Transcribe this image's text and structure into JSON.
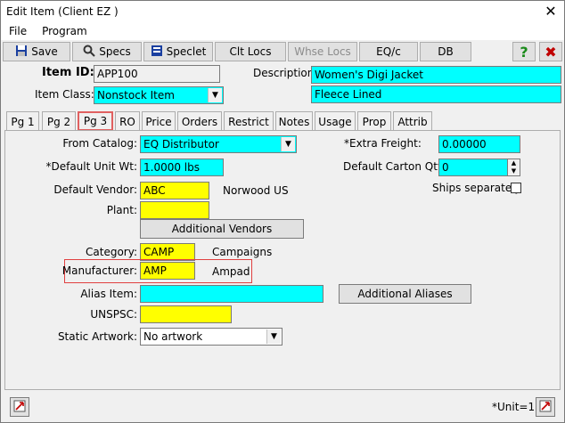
{
  "window": {
    "title": "Edit Item (Client EZ   )",
    "close_glyph": "✕"
  },
  "menu": {
    "items": [
      "File",
      "Program"
    ]
  },
  "toolbar": {
    "save": "Save",
    "specs": "Specs",
    "speclet": "Speclet",
    "clt_locs": "Clt Locs",
    "whse_locs": "Whse Locs",
    "eqc": "EQ/c",
    "db": "DB",
    "help_glyph": "?",
    "cancel_glyph": "✖"
  },
  "header": {
    "item_id_label": "Item ID:",
    "item_id_value": "APP100",
    "item_class_label": "Item Class:",
    "item_class_value": "Nonstock Item",
    "description_label": "Description:",
    "description_line1": "Women's Digi Jacket",
    "description_line2": "Fleece Lined"
  },
  "tabs": [
    "Pg 1",
    "Pg 2",
    "Pg 3",
    "RO",
    "Price",
    "Orders",
    "Restrict",
    "Notes",
    "Usage",
    "Prop",
    "Attrib"
  ],
  "active_tab": "Pg 3",
  "page3": {
    "from_catalog_label": "From Catalog:",
    "from_catalog_value": "EQ Distributor",
    "extra_freight_label": "*Extra Freight:",
    "extra_freight_value": "0.00000",
    "default_unit_wt_label": "*Default Unit Wt:",
    "default_unit_wt_value": "1.0000 lbs",
    "default_carton_qty_label": "Default Carton Qty:",
    "default_carton_qty_value": "0",
    "default_vendor_label": "Default Vendor:",
    "default_vendor_value": "ABC",
    "default_vendor_name": "Norwood US",
    "ships_separately_label": "Ships separately",
    "plant_label": "Plant:",
    "plant_value": "",
    "additional_vendors_button": "Additional Vendors",
    "category_label": "Category:",
    "category_value": "CAMP",
    "category_name": "Campaigns",
    "manufacturer_label": "Manufacturer:",
    "manufacturer_value": "AMP",
    "manufacturer_name": "Ampad",
    "alias_item_label": "Alias Item:",
    "alias_item_value": "",
    "additional_aliases_button": "Additional Aliases",
    "unspsc_label": "UNSPSC:",
    "unspsc_value": "",
    "static_artwork_label": "Static Artwork:",
    "static_artwork_value": "No artwork"
  },
  "footer": {
    "unit_text": "*Unit=1"
  },
  "colors": {
    "required": "#00ffff",
    "lookup": "#ffff00",
    "highlight_border": "#e04040"
  }
}
